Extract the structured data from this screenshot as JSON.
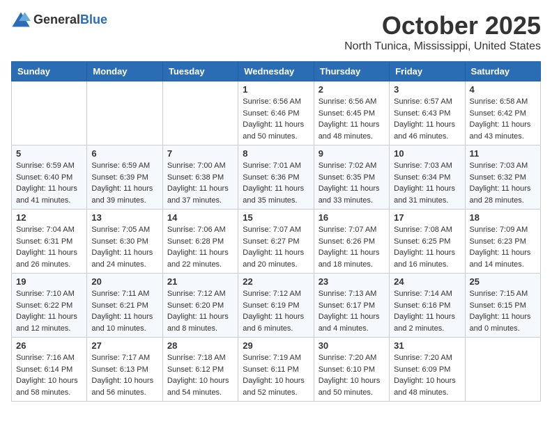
{
  "logo": {
    "general": "General",
    "blue": "Blue"
  },
  "title": "October 2025",
  "location": "North Tunica, Mississippi, United States",
  "days_of_week": [
    "Sunday",
    "Monday",
    "Tuesday",
    "Wednesday",
    "Thursday",
    "Friday",
    "Saturday"
  ],
  "weeks": [
    [
      {
        "day": "",
        "info": ""
      },
      {
        "day": "",
        "info": ""
      },
      {
        "day": "",
        "info": ""
      },
      {
        "day": "1",
        "info": "Sunrise: 6:56 AM\nSunset: 6:46 PM\nDaylight: 11 hours\nand 50 minutes."
      },
      {
        "day": "2",
        "info": "Sunrise: 6:56 AM\nSunset: 6:45 PM\nDaylight: 11 hours\nand 48 minutes."
      },
      {
        "day": "3",
        "info": "Sunrise: 6:57 AM\nSunset: 6:43 PM\nDaylight: 11 hours\nand 46 minutes."
      },
      {
        "day": "4",
        "info": "Sunrise: 6:58 AM\nSunset: 6:42 PM\nDaylight: 11 hours\nand 43 minutes."
      }
    ],
    [
      {
        "day": "5",
        "info": "Sunrise: 6:59 AM\nSunset: 6:40 PM\nDaylight: 11 hours\nand 41 minutes."
      },
      {
        "day": "6",
        "info": "Sunrise: 6:59 AM\nSunset: 6:39 PM\nDaylight: 11 hours\nand 39 minutes."
      },
      {
        "day": "7",
        "info": "Sunrise: 7:00 AM\nSunset: 6:38 PM\nDaylight: 11 hours\nand 37 minutes."
      },
      {
        "day": "8",
        "info": "Sunrise: 7:01 AM\nSunset: 6:36 PM\nDaylight: 11 hours\nand 35 minutes."
      },
      {
        "day": "9",
        "info": "Sunrise: 7:02 AM\nSunset: 6:35 PM\nDaylight: 11 hours\nand 33 minutes."
      },
      {
        "day": "10",
        "info": "Sunrise: 7:03 AM\nSunset: 6:34 PM\nDaylight: 11 hours\nand 31 minutes."
      },
      {
        "day": "11",
        "info": "Sunrise: 7:03 AM\nSunset: 6:32 PM\nDaylight: 11 hours\nand 28 minutes."
      }
    ],
    [
      {
        "day": "12",
        "info": "Sunrise: 7:04 AM\nSunset: 6:31 PM\nDaylight: 11 hours\nand 26 minutes."
      },
      {
        "day": "13",
        "info": "Sunrise: 7:05 AM\nSunset: 6:30 PM\nDaylight: 11 hours\nand 24 minutes."
      },
      {
        "day": "14",
        "info": "Sunrise: 7:06 AM\nSunset: 6:28 PM\nDaylight: 11 hours\nand 22 minutes."
      },
      {
        "day": "15",
        "info": "Sunrise: 7:07 AM\nSunset: 6:27 PM\nDaylight: 11 hours\nand 20 minutes."
      },
      {
        "day": "16",
        "info": "Sunrise: 7:07 AM\nSunset: 6:26 PM\nDaylight: 11 hours\nand 18 minutes."
      },
      {
        "day": "17",
        "info": "Sunrise: 7:08 AM\nSunset: 6:25 PM\nDaylight: 11 hours\nand 16 minutes."
      },
      {
        "day": "18",
        "info": "Sunrise: 7:09 AM\nSunset: 6:23 PM\nDaylight: 11 hours\nand 14 minutes."
      }
    ],
    [
      {
        "day": "19",
        "info": "Sunrise: 7:10 AM\nSunset: 6:22 PM\nDaylight: 11 hours\nand 12 minutes."
      },
      {
        "day": "20",
        "info": "Sunrise: 7:11 AM\nSunset: 6:21 PM\nDaylight: 11 hours\nand 10 minutes."
      },
      {
        "day": "21",
        "info": "Sunrise: 7:12 AM\nSunset: 6:20 PM\nDaylight: 11 hours\nand 8 minutes."
      },
      {
        "day": "22",
        "info": "Sunrise: 7:12 AM\nSunset: 6:19 PM\nDaylight: 11 hours\nand 6 minutes."
      },
      {
        "day": "23",
        "info": "Sunrise: 7:13 AM\nSunset: 6:17 PM\nDaylight: 11 hours\nand 4 minutes."
      },
      {
        "day": "24",
        "info": "Sunrise: 7:14 AM\nSunset: 6:16 PM\nDaylight: 11 hours\nand 2 minutes."
      },
      {
        "day": "25",
        "info": "Sunrise: 7:15 AM\nSunset: 6:15 PM\nDaylight: 11 hours\nand 0 minutes."
      }
    ],
    [
      {
        "day": "26",
        "info": "Sunrise: 7:16 AM\nSunset: 6:14 PM\nDaylight: 10 hours\nand 58 minutes."
      },
      {
        "day": "27",
        "info": "Sunrise: 7:17 AM\nSunset: 6:13 PM\nDaylight: 10 hours\nand 56 minutes."
      },
      {
        "day": "28",
        "info": "Sunrise: 7:18 AM\nSunset: 6:12 PM\nDaylight: 10 hours\nand 54 minutes."
      },
      {
        "day": "29",
        "info": "Sunrise: 7:19 AM\nSunset: 6:11 PM\nDaylight: 10 hours\nand 52 minutes."
      },
      {
        "day": "30",
        "info": "Sunrise: 7:20 AM\nSunset: 6:10 PM\nDaylight: 10 hours\nand 50 minutes."
      },
      {
        "day": "31",
        "info": "Sunrise: 7:20 AM\nSunset: 6:09 PM\nDaylight: 10 hours\nand 48 minutes."
      },
      {
        "day": "",
        "info": ""
      }
    ]
  ]
}
